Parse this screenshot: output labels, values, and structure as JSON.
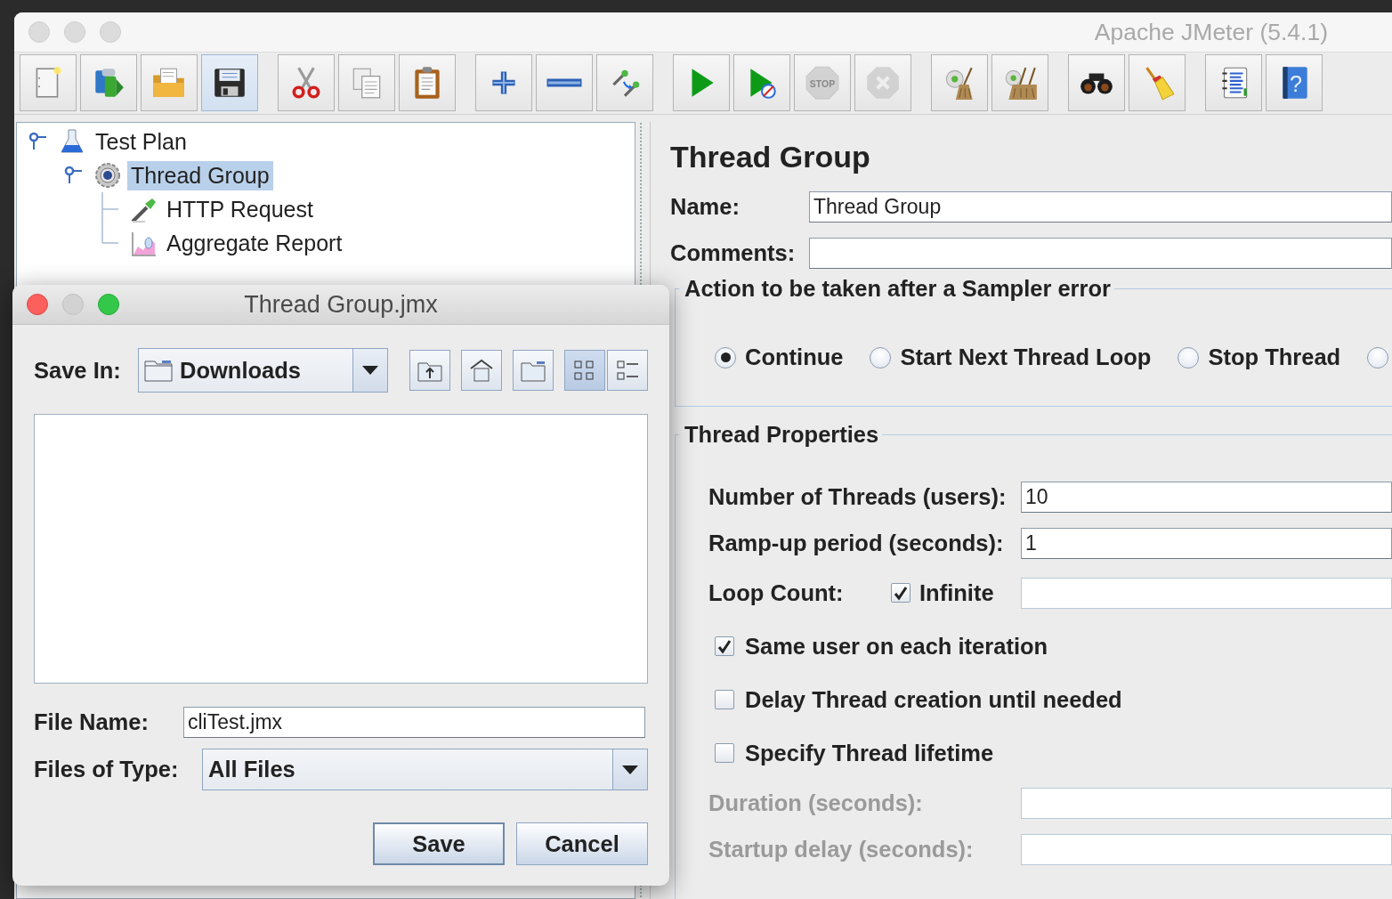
{
  "window": {
    "title": "Apache JMeter (5.4.1)"
  },
  "toolbar": {
    "groups": [
      {
        "items": [
          {
            "kind": "new",
            "disabled": false,
            "highlighted": false
          },
          {
            "kind": "templates",
            "disabled": false,
            "highlighted": false
          },
          {
            "kind": "open",
            "disabled": false,
            "highlighted": false
          },
          {
            "kind": "save",
            "disabled": false,
            "highlighted": true
          }
        ]
      },
      {
        "items": [
          {
            "kind": "cut",
            "disabled": false,
            "highlighted": false
          },
          {
            "kind": "copy",
            "disabled": false,
            "highlighted": false
          },
          {
            "kind": "paste",
            "disabled": false,
            "highlighted": false
          }
        ]
      },
      {
        "items": [
          {
            "kind": "expand",
            "disabled": false,
            "highlighted": false
          },
          {
            "kind": "collapse",
            "disabled": false,
            "highlighted": false
          },
          {
            "kind": "toggle",
            "disabled": false,
            "highlighted": false
          }
        ]
      },
      {
        "items": [
          {
            "kind": "start",
            "disabled": false,
            "highlighted": false
          },
          {
            "kind": "start-no-pauses",
            "disabled": false,
            "highlighted": false
          },
          {
            "kind": "stop",
            "text": "STOP",
            "disabled": true,
            "highlighted": false
          },
          {
            "kind": "shutdown",
            "disabled": true,
            "highlighted": false
          }
        ]
      },
      {
        "items": [
          {
            "kind": "clear",
            "disabled": false,
            "highlighted": false
          },
          {
            "kind": "clear-all",
            "disabled": false,
            "highlighted": false
          }
        ]
      },
      {
        "items": [
          {
            "kind": "search",
            "disabled": false,
            "highlighted": false
          },
          {
            "kind": "reset-search",
            "disabled": false,
            "highlighted": false
          }
        ]
      },
      {
        "items": [
          {
            "kind": "function-helper",
            "disabled": false,
            "highlighted": false
          },
          {
            "kind": "help",
            "text": "?",
            "disabled": false,
            "highlighted": false
          }
        ]
      }
    ]
  },
  "tree": [
    {
      "label": "Test Plan",
      "kind": "test-plan",
      "selected": false,
      "expanded": true,
      "children": [
        {
          "label": "Thread Group",
          "kind": "thread-group",
          "selected": true,
          "expanded": true,
          "children": [
            {
              "label": "HTTP Request",
              "kind": "sampler",
              "selected": false
            },
            {
              "label": "Aggregate Report",
              "kind": "listener",
              "selected": false
            }
          ]
        }
      ]
    }
  ],
  "editor": {
    "title": "Thread Group",
    "name": {
      "label": "Name:",
      "value": "Thread Group"
    },
    "comments": {
      "label": "Comments:"
    },
    "sampler_error": {
      "legend": "Action to be taken after a Sampler error",
      "options": [
        {
          "label": "Continue",
          "selected": true
        },
        {
          "label": "Start Next Thread Loop",
          "selected": false
        },
        {
          "label": "Stop Thread",
          "selected": false
        },
        {
          "selected": false
        }
      ]
    },
    "thread_properties": {
      "legend": "Thread Properties",
      "threads": {
        "label": "Number of Threads (users):",
        "value": "10"
      },
      "ramp_up": {
        "label": "Ramp-up period (seconds):",
        "value": "1"
      },
      "loop_count": {
        "label": "Loop Count:",
        "infinite": {
          "label": "Infinite",
          "checked": true
        }
      },
      "options": [
        {
          "label": "Same user on each iteration",
          "checked": true
        },
        {
          "label": "Delay Thread creation until needed",
          "checked": false
        },
        {
          "label": "Specify Thread lifetime",
          "checked": false
        }
      ],
      "lifetime_fields": [
        {
          "label": "Duration (seconds):",
          "disabled": true
        },
        {
          "label": "Startup delay (seconds):",
          "disabled": true
        }
      ]
    }
  },
  "save_dialog": {
    "title": "Thread Group.jmx",
    "save_in": {
      "label": "Save In:",
      "value": "Downloads"
    },
    "tools": [
      {
        "kind": "up-folder",
        "selected": false
      },
      {
        "kind": "home",
        "selected": false
      },
      {
        "kind": "new-folder",
        "selected": false
      },
      {
        "kind": "list-view",
        "selected": true
      },
      {
        "kind": "details-view",
        "selected": false
      }
    ],
    "file_name": {
      "label": "File Name:",
      "value": "cliTest.jmx"
    },
    "file_type": {
      "label": "Files of Type:",
      "value": "All Files"
    },
    "buttons": [
      {
        "label": "Save",
        "default": true
      },
      {
        "label": "Cancel",
        "default": false
      }
    ]
  }
}
